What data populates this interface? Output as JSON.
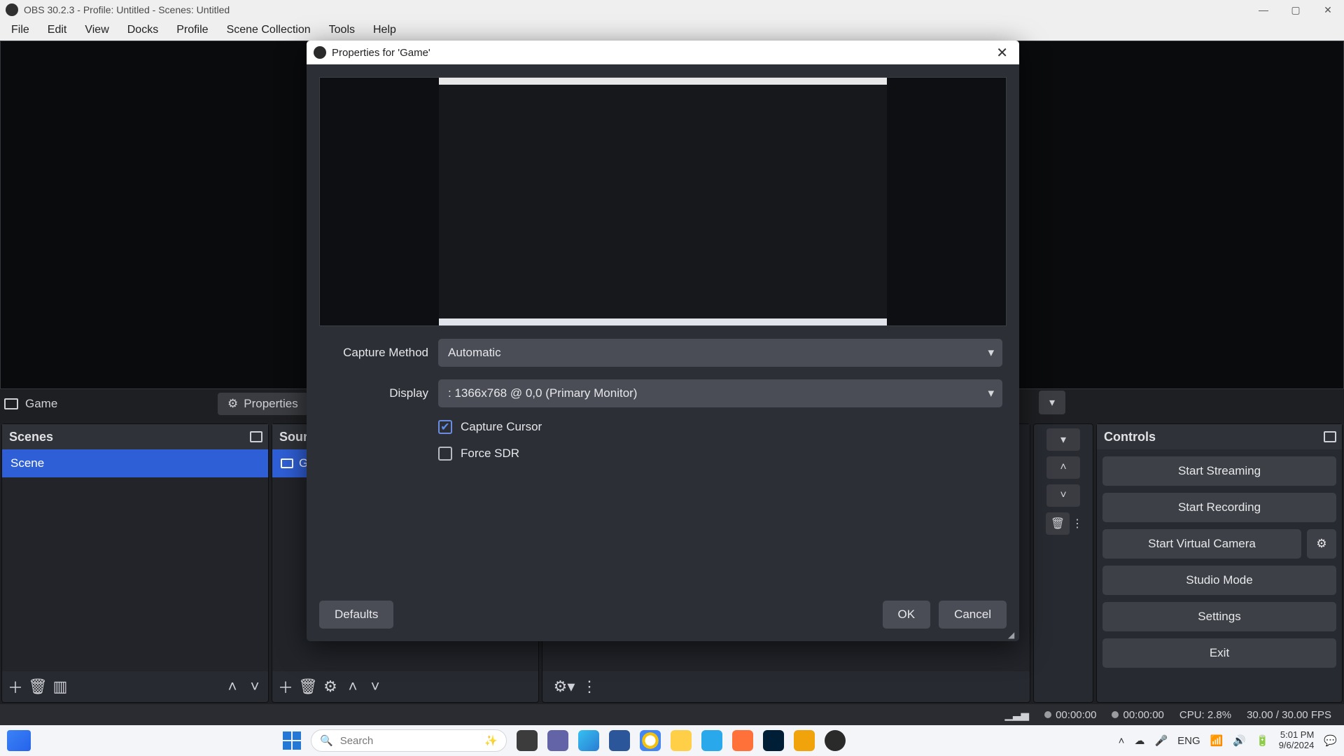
{
  "titlebar": {
    "text": "OBS 30.2.3 - Profile: Untitled - Scenes: Untitled"
  },
  "menubar": {
    "items": [
      "File",
      "Edit",
      "View",
      "Docks",
      "Profile",
      "Scene Collection",
      "Tools",
      "Help"
    ]
  },
  "source_toolbar": {
    "source_name": "Game",
    "properties_label": "Properties"
  },
  "docks": {
    "scenes": {
      "title": "Scenes",
      "items": [
        "Scene"
      ]
    },
    "sources": {
      "title": "Sour",
      "items": [
        "G"
      ]
    },
    "controls": {
      "title": "Controls",
      "buttons": {
        "start_streaming": "Start Streaming",
        "start_recording": "Start Recording",
        "start_virtual_camera": "Start Virtual Camera",
        "studio_mode": "Studio Mode",
        "settings": "Settings",
        "exit": "Exit"
      }
    }
  },
  "statusbar": {
    "stream_time": "00:00:00",
    "record_time": "00:00:00",
    "cpu": "CPU: 2.8%",
    "fps": "30.00 / 30.00 FPS"
  },
  "modal": {
    "title": "Properties for 'Game'",
    "fields": {
      "capture_method": {
        "label": "Capture Method",
        "value": "Automatic"
      },
      "display": {
        "label": "Display",
        "value": ": 1366x768 @ 0,0 (Primary Monitor)"
      },
      "capture_cursor": {
        "label": "Capture Cursor",
        "checked": true
      },
      "force_sdr": {
        "label": "Force SDR",
        "checked": false
      }
    },
    "buttons": {
      "defaults": "Defaults",
      "ok": "OK",
      "cancel": "Cancel"
    }
  },
  "taskbar": {
    "search_placeholder": "Search",
    "lang": "ENG",
    "time": "5:01 PM",
    "date": "9/6/2024"
  },
  "colors": {
    "accent": "#2f5fd6"
  }
}
